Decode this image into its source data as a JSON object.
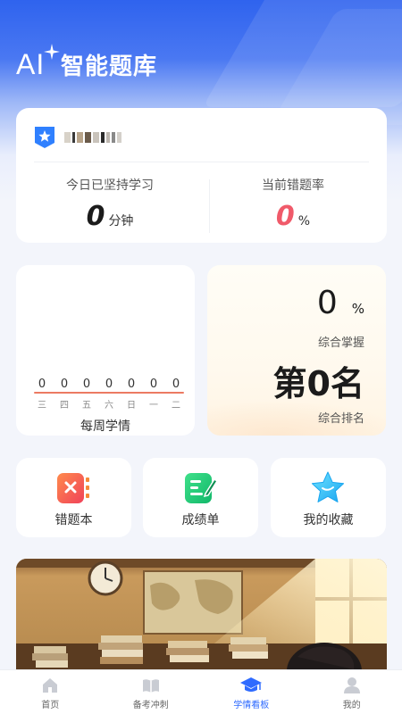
{
  "header": {
    "logo_text": "AI",
    "title": "智能题库"
  },
  "profile": {
    "stat_study": {
      "label": "今日已坚持学习",
      "value": "0",
      "unit": "分钟"
    },
    "stat_error": {
      "label": "当前错题率",
      "value": "0",
      "unit": "%"
    }
  },
  "weekly": {
    "title": "每周学情",
    "values": [
      "0",
      "0",
      "0",
      "0",
      "0",
      "0",
      "0"
    ],
    "days": [
      "三",
      "四",
      "五",
      "六",
      "日",
      "一",
      "二"
    ]
  },
  "mastery": {
    "value": "0",
    "unit": "%",
    "label": "综合掌握",
    "rank": "第0名",
    "rank_label": "综合排名"
  },
  "tools": [
    {
      "label": "错题本",
      "icon": "wrong-book-icon"
    },
    {
      "label": "成绩单",
      "icon": "report-card-icon"
    },
    {
      "label": "我的收藏",
      "icon": "star-icon"
    }
  ],
  "tabs": [
    {
      "label": "首页",
      "icon": "home-icon",
      "active": false
    },
    {
      "label": "备考冲刺",
      "icon": "book-icon",
      "active": false
    },
    {
      "label": "学情看板",
      "icon": "graduation-cap-icon",
      "active": true
    },
    {
      "label": "我的",
      "icon": "user-icon",
      "active": false
    }
  ],
  "colors": {
    "primary": "#2f6bff",
    "error_rate": "#f05a6a",
    "week_line": "#ec7a62"
  }
}
